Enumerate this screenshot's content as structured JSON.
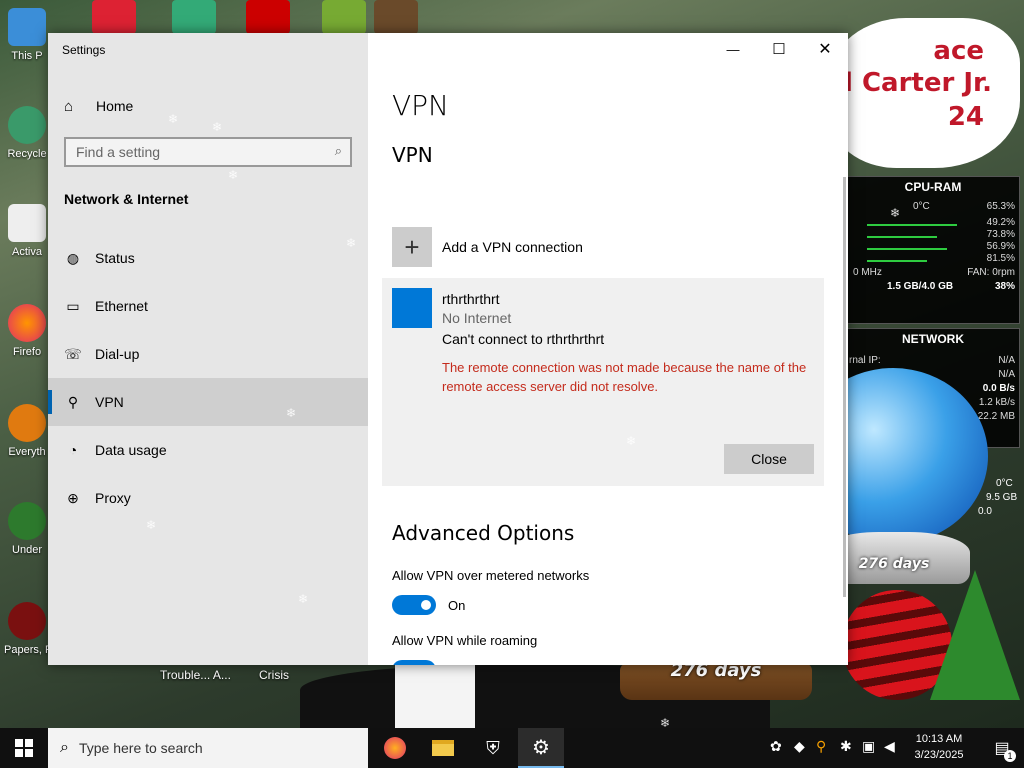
{
  "desktop": {
    "icons": [
      {
        "label": "This P"
      },
      {
        "label": "Recycle"
      },
      {
        "label": "Activa"
      },
      {
        "label": "Firefo"
      },
      {
        "label": "Everyth"
      },
      {
        "label": "Under"
      },
      {
        "label": "Papers, P"
      }
    ],
    "under_window_labels": [
      "Trouble... A...",
      "Crisis"
    ],
    "banner_lines": [
      "ace",
      "l Carter Jr.",
      "24"
    ],
    "cpu_gadget": {
      "title": "CPU-RAM",
      "temp": "0°C",
      "total": "65.3%",
      "cores": [
        "49.2%",
        "73.8%",
        "56.9%",
        "81.5%"
      ],
      "freq": "0 MHz",
      "fan": "FAN: 0rpm",
      "ram": "1.5 GB/4.0 GB",
      "ram_pct": "38%"
    },
    "net_gadget": {
      "title": "NETWORK",
      "rows": [
        {
          "label": "rnal IP:",
          "value": "N/A"
        },
        {
          "label": "",
          "value": "N/A"
        },
        {
          "label": "",
          "value": "0.0 B/s"
        },
        {
          "label": "",
          "value": "1.2 kB/s"
        },
        {
          "label": "",
          "value": "22.2 MB"
        }
      ]
    },
    "gadget_extra": {
      "temp2": "0°C",
      "ram2": "9.5 GB",
      "val3": "0.0"
    },
    "globe_small_label": "276 days",
    "globe_large_label": "276 days"
  },
  "window": {
    "app_title": "Settings",
    "controls": {
      "minimize": "—",
      "maximize": "☐",
      "close": "✕"
    },
    "nav": {
      "home": "Home",
      "search_placeholder": "Find a setting",
      "section": "Network & Internet",
      "items": [
        {
          "label": "Status",
          "icon": "globe-status-icon"
        },
        {
          "label": "Ethernet",
          "icon": "ethernet-icon"
        },
        {
          "label": "Dial-up",
          "icon": "dialup-icon"
        },
        {
          "label": "VPN",
          "icon": "vpn-icon"
        },
        {
          "label": "Data usage",
          "icon": "data-usage-icon"
        },
        {
          "label": "Proxy",
          "icon": "proxy-icon"
        }
      ],
      "active": "VPN"
    },
    "content": {
      "page_title": "VPN",
      "section_title": "VPN",
      "add_label": "Add a VPN connection",
      "connection": {
        "name": "rthrthrthrt",
        "status": "No Internet",
        "error_title": "Can't connect to rthrthrthrt",
        "error_detail": "The remote connection was not made because the name of the remote access server did not resolve.",
        "close_label": "Close"
      },
      "advanced_title": "Advanced Options",
      "options": [
        {
          "label": "Allow VPN over metered networks",
          "state": "On"
        },
        {
          "label": "Allow VPN while roaming",
          "state": "On"
        }
      ]
    }
  },
  "taskbar": {
    "search_placeholder": "Type here to search",
    "time": "10:13 AM",
    "date": "3/23/2025",
    "notification_count": "1"
  }
}
